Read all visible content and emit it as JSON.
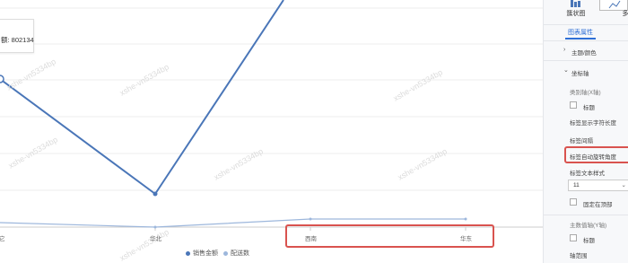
{
  "chart": {
    "tooltip_text": "额: 802134",
    "categories": [
      "华北",
      "西南",
      "华东"
    ],
    "first_category_partial": "它",
    "legend": [
      "销售金额",
      "配送数"
    ],
    "watermark": "xshe-vn5334bp"
  },
  "panel": {
    "chart_types": [
      "簇状图",
      "多线图"
    ],
    "section_tab": "图表属性",
    "theme_color": "主题/颜色",
    "axis": "坐标轴",
    "category_axis": "类别轴(X轴)",
    "title_label": "标题",
    "label_show_length": "标签显示字符长度",
    "label_interval": "标签间隔",
    "label_auto_rotate": "标签自动旋转角度",
    "label_text_style": "标签文本样式",
    "font_size_value": "11",
    "fixed_top": "固定在顶部",
    "main_value_axis": "主数值轴(Y轴)",
    "title_label2": "标题",
    "axis_range": "轴范围"
  },
  "colors": {
    "series1": "#4a76b8",
    "series2": "#9db7dc",
    "highlight": "#d9534f",
    "accent": "#2f6fd6"
  },
  "chart_data": {
    "type": "line",
    "categories": [
      "它",
      "华北",
      "西南",
      "华东"
    ],
    "series": [
      {
        "name": "销售金额",
        "values": [
          802134,
          240000,
          1350000,
          null
        ]
      },
      {
        "name": "配送数",
        "values": [
          20000,
          10000,
          25000,
          25000
        ]
      }
    ]
  }
}
